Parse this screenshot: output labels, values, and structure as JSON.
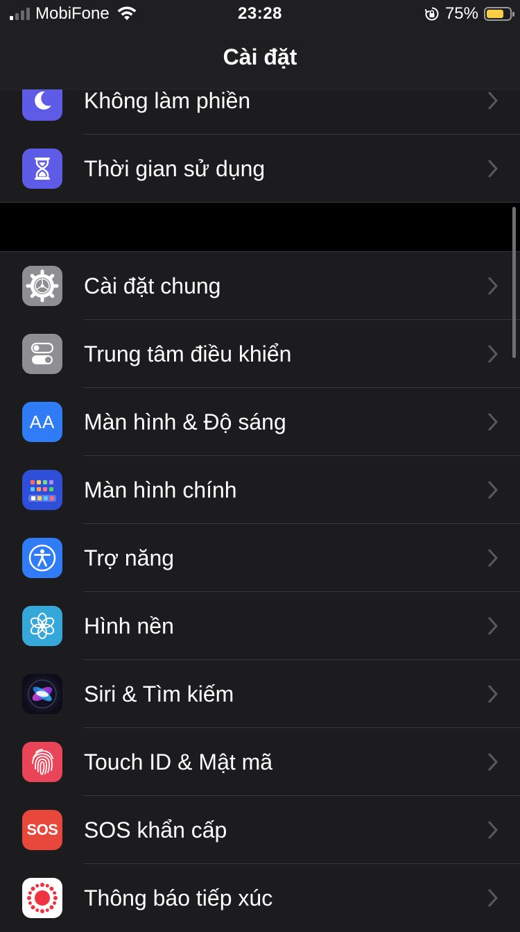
{
  "status_bar": {
    "carrier": "MobiFone",
    "time": "23:28",
    "battery_percent": "75%",
    "battery_level": 0.75,
    "battery_color": "#f7ce46",
    "signal_bars_on": 1,
    "signal_bars_total": 4,
    "icons": [
      "wifi-icon",
      "orientation-lock-icon",
      "battery-icon"
    ]
  },
  "header": {
    "title": "Cài đặt"
  },
  "group1": {
    "items": [
      {
        "label": "Không làm phiền",
        "icon": "moon-icon",
        "color": "#5e5ce6"
      },
      {
        "label": "Thời gian sử dụng",
        "icon": "hourglass-icon",
        "color": "#5e5ce6"
      }
    ]
  },
  "group2": {
    "items": [
      {
        "label": "Cài đặt chung",
        "icon": "gear-icon",
        "color": "#8e8e93"
      },
      {
        "label": "Trung tâm điều khiển",
        "icon": "toggles-icon",
        "color": "#8e8e93"
      },
      {
        "label": "Màn hình & Độ sáng",
        "icon": "text-size-icon",
        "color": "#2f7cf6"
      },
      {
        "label": "Màn hình chính",
        "icon": "home-screen-icon",
        "color": "#2f4fd8"
      },
      {
        "label": "Trợ năng",
        "icon": "accessibility-icon",
        "color": "#2f7cf6"
      },
      {
        "label": "Hình nền",
        "icon": "flower-icon",
        "color": "#35a7d8"
      },
      {
        "label": "Siri & Tìm kiếm",
        "icon": "siri-icon",
        "color": "#1a1a2e"
      },
      {
        "label": "Touch ID & Mật mã",
        "icon": "fingerprint-icon",
        "color": "#ea4458"
      },
      {
        "label": "SOS khẩn cấp",
        "icon": "sos-icon",
        "color": "#e8473b"
      },
      {
        "label": "Thông báo tiếp xúc",
        "icon": "exposure-icon",
        "color": "#ffffff"
      }
    ]
  },
  "sos_icon_text": "SOS",
  "text_size_icon_text": "AA"
}
